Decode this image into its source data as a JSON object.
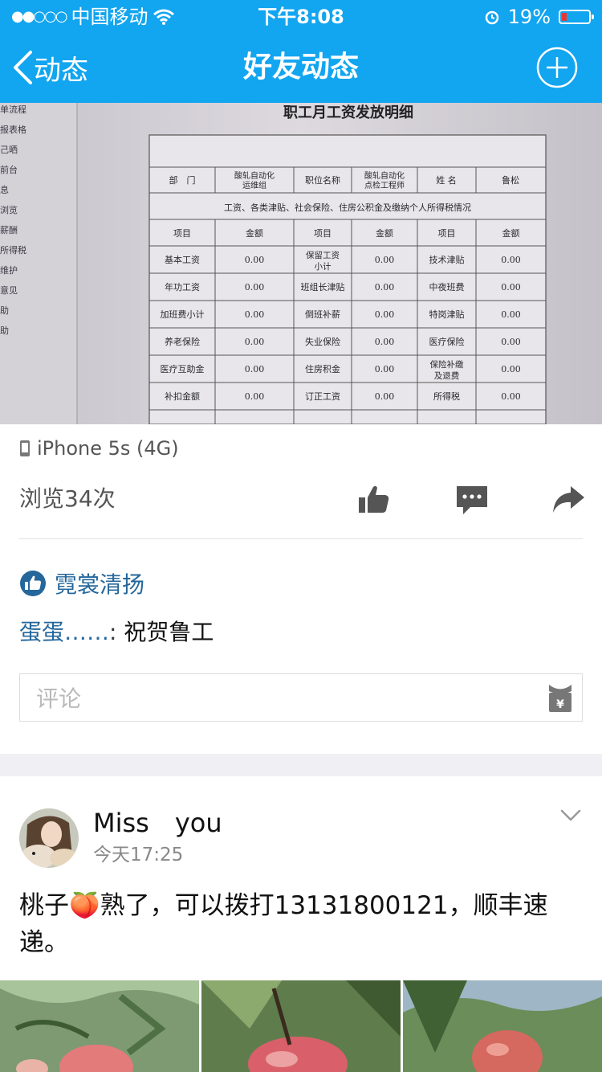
{
  "status_bar": {
    "carrier": "中国移动",
    "time": "下午8:08",
    "battery_percent": "19%",
    "battery_level": 0.19,
    "battery_color": "#e53935"
  },
  "nav": {
    "back_label": "动态",
    "title": "好友动态",
    "add_icon": "plus-circle-icon",
    "bar_color": "#12a5f0"
  },
  "post": {
    "device": "iPhone 5s (4G)",
    "views": "浏览34次",
    "actions": [
      "thumbs-up-icon",
      "comment-icon",
      "share-icon"
    ],
    "likes": {
      "icon": "thumbs-up-badge-icon",
      "name": "霓裳清扬"
    },
    "comments": [
      {
        "author": "蛋蛋……",
        "sep": ": ",
        "text": "祝贺鲁工"
      }
    ],
    "comment_placeholder": "评论",
    "gift_icon": "red-packet-icon"
  },
  "salary_doc": {
    "title": "职工月工资发放明细",
    "dept_label": "部　门",
    "dept_value": "酸轧自动化运维组",
    "position_label": "职位名称",
    "position_value": "酸轧自动化点检工程师",
    "name_label": "姓 名",
    "name_value": "鲁松",
    "section_title": "工资、各类津贴、社会保险、住房公积金及缴纳个人所得税情况",
    "col_item": "项目",
    "col_amount": "金额",
    "rows": [
      [
        "基本工资",
        "0.00",
        "保留工资小计",
        "0.00",
        "技术津贴",
        "0.00"
      ],
      [
        "年功工资",
        "0.00",
        "班组长津贴",
        "0.00",
        "中夜班费",
        "0.00"
      ],
      [
        "加班费小计",
        "0.00",
        "倒班补薪",
        "0.00",
        "特岗津贴",
        "0.00"
      ],
      [
        "养老保险",
        "0.00",
        "失业保险",
        "0.00",
        "医疗保险",
        "0.00"
      ],
      [
        "医疗互助金",
        "0.00",
        "住房积金",
        "0.00",
        "保险补缴及退费",
        "0.00"
      ],
      [
        "补扣金额",
        "0.00",
        "订正工资",
        "0.00",
        "所得税",
        "0.00"
      ]
    ],
    "side_menu": [
      "单流程",
      "报表格",
      "己晒",
      "前台",
      "息",
      "浏览",
      "薪酬",
      "所得税",
      "维护",
      "意见",
      "助",
      "助"
    ]
  },
  "next_post": {
    "author": "Miss　you",
    "time": "今天17:25",
    "text_before": "桃子",
    "emoji": "🍑",
    "text_after": "熟了，可以拨打13131800121，顺丰速递。",
    "menu_icon": "chevron-down-icon",
    "images": [
      "peach-photo-1",
      "peach-photo-2",
      "peach-photo-3"
    ]
  }
}
